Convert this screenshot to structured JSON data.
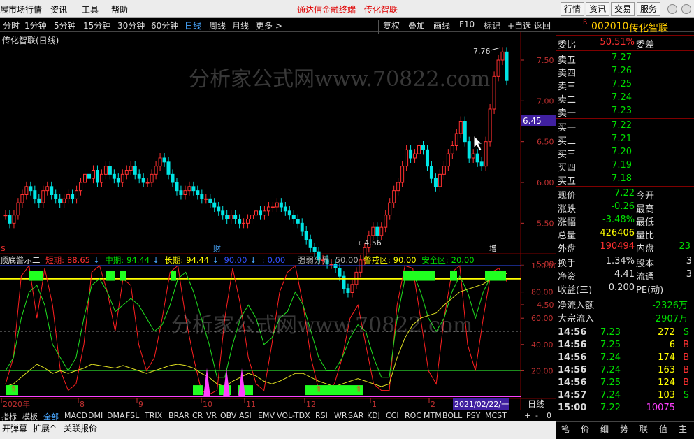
{
  "menubar": {
    "left_label": "展市场行情",
    "menu": [
      "资讯",
      "工具",
      "帮助"
    ],
    "title_red": "通达信金融终端",
    "title_stock": "传化智联",
    "right_tabs": [
      "行情",
      "资讯",
      "交易",
      "服务"
    ]
  },
  "toolbar": {
    "periods": [
      "分时",
      "1分钟",
      "5分钟",
      "15分钟",
      "30分钟",
      "60分钟",
      "日线",
      "周线",
      "月线",
      "更多 >"
    ],
    "right": [
      "复权",
      "叠加",
      "画线",
      "F10",
      "标记",
      "+自选",
      "返回"
    ]
  },
  "chart": {
    "title": "传化智联(日线)",
    "high_label": "7.76",
    "low_label": "4.56",
    "current_price_label": "6.45",
    "watermark": "分析家公式网www.70822.com",
    "price_ticks": [
      "7.50",
      "7.00",
      "6.50",
      "6.00",
      "5.50",
      "5.00",
      "4.50"
    ],
    "marker_cai": "财",
    "marker_zeng": "增",
    "ind_ticks": [
      "100.00",
      "80.00",
      "60.00",
      "40.00",
      "20.00"
    ],
    "date_labels": [
      "2020年",
      "8",
      "9",
      "10",
      "11",
      "12",
      "1",
      "2"
    ],
    "date_box": "2021/02/22/一",
    "period_label": "日线"
  },
  "indicator": {
    "name": "顶底警示二",
    "short_label": "短期:",
    "short_val": "88.65",
    "mid_label": "中期:",
    "mid_val": "94.44",
    "long_label": "长期:",
    "long_val": "94.44",
    "v1": "90.00",
    "v2": "0.00",
    "strong_label": "强弱分界:",
    "strong_val": "50.00",
    "warn_label": "警戒区:",
    "warn_val": "90.00",
    "safe_label": "安全区:",
    "safe_val": "20.00"
  },
  "quote": {
    "code": "002010",
    "name": "传化智联",
    "wb_label": "委比",
    "wb_val": "50.51%",
    "wc_label": "委差",
    "asks": [
      {
        "l": "卖五",
        "p": "7.27"
      },
      {
        "l": "卖四",
        "p": "7.26"
      },
      {
        "l": "卖三",
        "p": "7.25"
      },
      {
        "l": "卖二",
        "p": "7.24"
      },
      {
        "l": "卖一",
        "p": "7.23"
      }
    ],
    "bids": [
      {
        "l": "买一",
        "p": "7.22"
      },
      {
        "l": "买二",
        "p": "7.21"
      },
      {
        "l": "买三",
        "p": "7.20"
      },
      {
        "l": "买四",
        "p": "7.19"
      },
      {
        "l": "买五",
        "p": "7.18"
      }
    ],
    "stats": [
      {
        "l": "现价",
        "v": "7.22",
        "c": "green",
        "l2": "今开",
        "v2": ""
      },
      {
        "l": "涨跌",
        "v": "-0.26",
        "c": "green",
        "l2": "最高",
        "v2": ""
      },
      {
        "l": "涨幅",
        "v": "-3.48%",
        "c": "green",
        "l2": "最低",
        "v2": ""
      },
      {
        "l": "总量",
        "v": "426406",
        "c": "yellow",
        "l2": "量比",
        "v2": ""
      },
      {
        "l": "外盘",
        "v": "190494",
        "c": "red",
        "l2": "内盘",
        "v2": "23"
      }
    ],
    "stats2": [
      {
        "l": "换手",
        "v": "1.34%",
        "l2": "股本",
        "v2": "3"
      },
      {
        "l": "净资",
        "v": "4.41",
        "l2": "流通",
        "v2": "3"
      },
      {
        "l": "收益(三)",
        "v": "0.200",
        "l2": "PE(动)",
        "v2": ""
      }
    ],
    "flows": [
      {
        "l": "净流入额",
        "v": "-2326万"
      },
      {
        "l": "大宗流入",
        "v": "-2907万"
      }
    ],
    "ticks": [
      {
        "t": "14:56",
        "p": "7.23",
        "q": "272",
        "f": "S"
      },
      {
        "t": "14:56",
        "p": "7.25",
        "q": "6",
        "f": "B"
      },
      {
        "t": "14:56",
        "p": "7.24",
        "q": "174",
        "f": "B"
      },
      {
        "t": "14:56",
        "p": "7.24",
        "q": "163",
        "f": "B"
      },
      {
        "t": "14:56",
        "p": "7.25",
        "q": "124",
        "f": "B"
      },
      {
        "t": "14:57",
        "p": "7.24",
        "q": "103",
        "f": "S"
      },
      {
        "t": "15:00",
        "p": "7.22",
        "q": "10075",
        "f": ""
      }
    ]
  },
  "bottabs": [
    "指标",
    "模板",
    "全部",
    "MACD",
    "DMI",
    "DMA",
    "FSL",
    "TRIX",
    "BRAR",
    "CR",
    "VR",
    "OBV",
    "ASI",
    "EMV",
    "VOL-TDX",
    "RSI",
    "WR",
    "SAR",
    "KDJ",
    "CCI",
    "ROC",
    "MTM",
    "BOLL",
    "PSY",
    "MCST"
  ],
  "status": [
    "开弹幕",
    "扩展^",
    "关联报价"
  ],
  "rightbot": [
    "笔",
    "价",
    "细",
    "势",
    "联",
    "值",
    "主"
  ],
  "colors": {
    "up": "#ff3030",
    "down": "#00e5e5",
    "short": "#ff2020",
    "mid": "#20e020",
    "long": "#e0e020"
  }
}
